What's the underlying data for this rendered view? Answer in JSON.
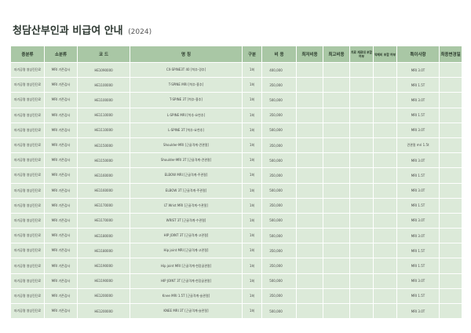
{
  "title": {
    "main": "청담산부인과 비급여 안내",
    "year": "(2024)"
  },
  "columns": {
    "category": "중분류",
    "subcategory": "소분류",
    "code": "코 드",
    "name": "명 칭",
    "unit": "구분",
    "price": "비 용",
    "min": "최저비용",
    "max": "최고비용",
    "material": "치료 재료대 포함 여부",
    "drug": "약제비 포함 여부",
    "note": "특이사항",
    "changed": "최종변경일"
  },
  "rows": [
    {
      "category": "자기공명 영상진단료",
      "sub": "MRI 기존검사",
      "code": "HE1090000",
      "name": "CX-SPINE3T 40 [척추-경추]",
      "unit": "1회",
      "price": "400,000",
      "note": "MRI 3.0T"
    },
    {
      "category": "자기공명 영상진단료",
      "sub": "MRI 기존검사",
      "code": "HE1100000",
      "name": "T-SPINE MRI [척추-흉추]",
      "unit": "1회",
      "price": "350,000",
      "note": "MRI 1.5T"
    },
    {
      "category": "자기공명 영상진단료",
      "sub": "MRI 기존검사",
      "code": "HE1100000",
      "name": "T-SPINE 3T [척추-흉추]",
      "unit": "1회",
      "price": "500,000",
      "note": "MRI 3.0T"
    },
    {
      "category": "자기공명 영상진단료",
      "sub": "MRI 기존검사",
      "code": "HE1110000",
      "name": "L-SPINE MRI [척추-요천추]",
      "unit": "1회",
      "price": "350,000",
      "note": "MRI 1.5T"
    },
    {
      "category": "자기공명 영상진단료",
      "sub": "MRI 기존검사",
      "code": "HE1110000",
      "name": "L-SPINE 3T [척추-요천추]",
      "unit": "1회",
      "price": "500,000",
      "note": "MRI 3.0T"
    },
    {
      "category": "자기공명 영상진단료",
      "sub": "MRI 기존검사",
      "code": "HE1150000",
      "name": "Shoulder-MRI [근골격계-견관절]",
      "unit": "1회",
      "price": "350,000",
      "note": "견관절 mri 1.5t"
    },
    {
      "category": "자기공명 영상진단료",
      "sub": "MRI 기존검사",
      "code": "HE1150000",
      "name": "Shoulder-MRI 3T [근골격계-견관절]",
      "unit": "1회",
      "price": "500,000",
      "note": "MRI 3.0T"
    },
    {
      "category": "자기공명 영상진단료",
      "sub": "MRI 기존검사",
      "code": "HE1160000",
      "name": "ELBOW MRI [근골격계-주관절]",
      "unit": "1회",
      "price": "350,000",
      "note": "MRI 1.5T"
    },
    {
      "category": "자기공명 영상진단료",
      "sub": "MRI 기존검사",
      "code": "HE1160000",
      "name": "ELBOW 3T [근골격계-주관절]",
      "unit": "1회",
      "price": "500,000",
      "note": "MRI 3.0T"
    },
    {
      "category": "자기공명 영상진단료",
      "sub": "MRI 기존검사",
      "code": "HE1170000",
      "name": "LT Wrist MRI [근골격계-수관절]",
      "unit": "1회",
      "price": "350,000",
      "note": "MRI 1.5T"
    },
    {
      "category": "자기공명 영상진단료",
      "sub": "MRI 기존검사",
      "code": "HE1170000",
      "name": "WRIST 3T [근골격계-수관절]",
      "unit": "1회",
      "price": "500,000",
      "note": "MRI 3.0T"
    },
    {
      "category": "자기공명 영상진단료",
      "sub": "MRI 기존검사",
      "code": "HE1180000",
      "name": "HIP JOINT 3T [근골격계-고관절]",
      "unit": "1회",
      "price": "500,000",
      "note": "MRI 3.0T"
    },
    {
      "category": "자기공명 영상진단료",
      "sub": "MRI 기존검사",
      "code": "HE1180000",
      "name": "Hip joint MRI [근골격계-고관절]",
      "unit": "1회",
      "price": "350,000",
      "note": "MRI 1.5T"
    },
    {
      "category": "자기공명 영상진단료",
      "sub": "MRI 기존검사",
      "code": "HE1190000",
      "name": "Hip joint MRI [근골격계-천장골관절]",
      "unit": "1회",
      "price": "350,000",
      "note": "MRI 1.5T"
    },
    {
      "category": "자기공명 영상진단료",
      "sub": "MRI 기존검사",
      "code": "HE1190000",
      "name": "HIP JOINT 3T [근골격계-천장골관절]",
      "unit": "1회",
      "price": "500,000",
      "note": "MRI 3.0T"
    },
    {
      "category": "자기공명 영상진단료",
      "sub": "MRI 기존검사",
      "code": "HE1200000",
      "name": "Knee MRI 1.5T [근골격계-슬관절]",
      "unit": "1회",
      "price": "350,000",
      "note": "MRI 1.5T"
    },
    {
      "category": "자기공명 영상진단료",
      "sub": "MRI 기존검사",
      "code": "HE1200000",
      "name": "KNEE MRI 3T [근골격계-슬관절]",
      "unit": "1회",
      "price": "500,000",
      "note": "MRI 3.0T"
    }
  ],
  "colors": {
    "header_bg": "#a9c7a5",
    "row_bg": "#dcead9",
    "border": "#ffffff"
  }
}
